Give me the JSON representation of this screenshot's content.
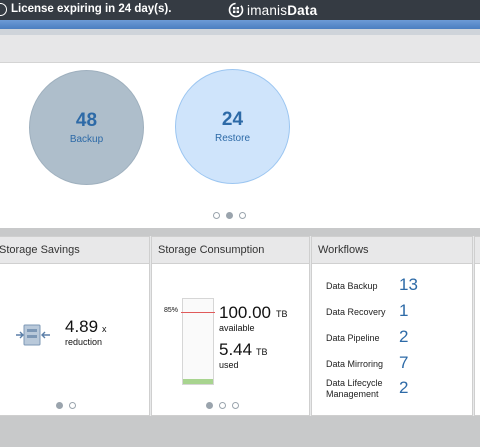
{
  "topbar": {
    "license_text": "License expiring in 24 day(s).",
    "logo_light": "imanis",
    "logo_bold": "Data",
    "alert_icon": "alert-circle-icon",
    "logo_icon": "imanis-logo-icon"
  },
  "summary": {
    "backup_count": "48",
    "backup_label": "Backup",
    "restore_count": "24",
    "restore_label": "Restore",
    "carousel_page": 2,
    "carousel_pages": 3
  },
  "storage_savings": {
    "title": "Storage Savings",
    "value": "4.89",
    "unit": "x",
    "label": "reduction",
    "icon": "compress-icon",
    "carousel_page": 1,
    "carousel_pages": 2
  },
  "storage_consumption": {
    "title": "Storage Consumption",
    "gauge_label": "85%",
    "gauge_fraction": 0.85,
    "available_value": "100.00",
    "available_unit": "TB",
    "available_label": "available",
    "used_value": "5.44",
    "used_unit": "TB",
    "used_label": "used",
    "carousel_page": 1,
    "carousel_pages": 3
  },
  "workflows": {
    "title": "Workflows",
    "items": [
      {
        "label": "Data Backup",
        "count": "13"
      },
      {
        "label": "Data Recovery",
        "count": "1"
      },
      {
        "label": "Data Pipeline",
        "count": "2"
      },
      {
        "label": "Data Mirroring",
        "count": "7"
      },
      {
        "label": "Data Lifecycle Management",
        "label_line1": "Data Lifecycle",
        "label_line2": "Management",
        "count": "2"
      }
    ]
  },
  "colors": {
    "topbar": "#353b43",
    "accent": "#4b7ec0",
    "link_blue": "#2d6aa7",
    "backup_circle": "#aebecb",
    "restore_circle": "#cfe4fb",
    "gauge_fill": "#a8d48f",
    "gauge_threshold": "#e05a5a"
  }
}
